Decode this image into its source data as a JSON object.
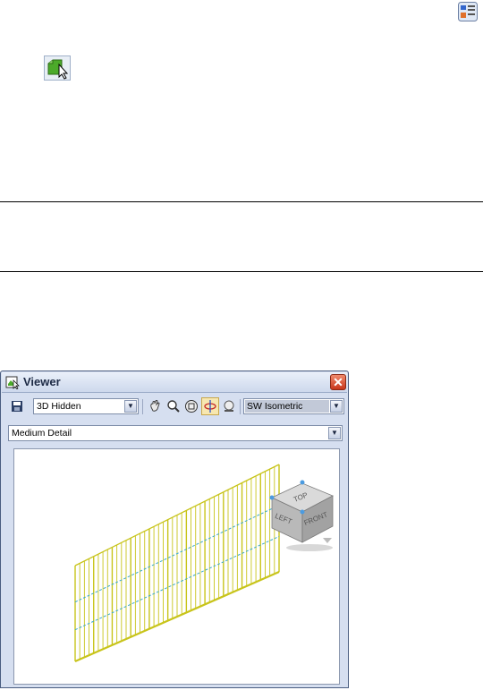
{
  "icons": {
    "corner": "palette-icon",
    "viewer_cursor": "viewer-cursor-icon"
  },
  "viewer": {
    "title": "Viewer",
    "close_label": "✕",
    "visual_style": "3D Hidden",
    "view": "SW Isometric",
    "detail_level": "Medium Detail",
    "viewcube": {
      "top": "TOP",
      "left": "LEFT",
      "front": "FRONT"
    }
  },
  "colors": {
    "frame": "#d6dff0",
    "wall": "#c8c41a",
    "accent": "#3aa9c9"
  }
}
